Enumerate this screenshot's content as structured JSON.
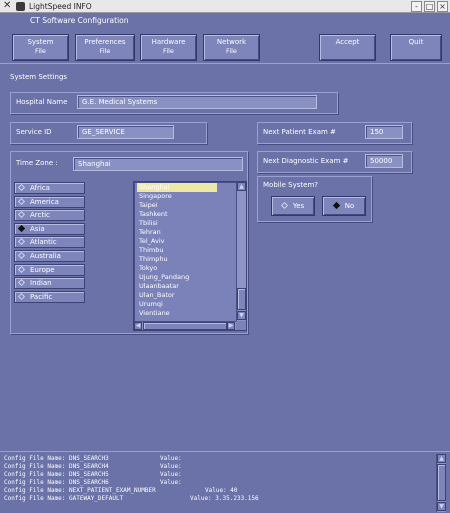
{
  "window": {
    "title": "LightSpeed INFO",
    "buttons": [
      "-",
      "□",
      "×"
    ]
  },
  "app_title": "CT Software Configuration",
  "toolbar": {
    "system": {
      "label": "System",
      "sub": "File"
    },
    "preferences": {
      "label": "Preferences",
      "sub": "File"
    },
    "hardware": {
      "label": "Hardware",
      "sub": "File"
    },
    "network": {
      "label": "Network",
      "sub": "File"
    },
    "accept": "Accept",
    "quit": "Quit"
  },
  "system_settings_label": "System Settings",
  "hospital": {
    "label": "Hospital Name",
    "value": "G.E. Medical Systems"
  },
  "service": {
    "label": "Service ID",
    "value": "GE_SERVICE"
  },
  "next_patient": {
    "label": "Next Patient Exam #",
    "value": "150"
  },
  "next_diagnostic": {
    "label": "Next Diagnostic Exam #",
    "value": "50000"
  },
  "timezone": {
    "label": "Time Zone :",
    "value": "Shanghai",
    "regions": [
      {
        "label": "Africa",
        "selected": false
      },
      {
        "label": "America",
        "selected": false
      },
      {
        "label": "Arctic",
        "selected": false
      },
      {
        "label": "Asia",
        "selected": true
      },
      {
        "label": "Atlantic",
        "selected": false
      },
      {
        "label": "Australia",
        "selected": false
      },
      {
        "label": "Europe",
        "selected": false
      },
      {
        "label": "Indian",
        "selected": false
      },
      {
        "label": "Pacific",
        "selected": false
      }
    ],
    "cities": [
      "Shanghai",
      "Singapore",
      "Taipei",
      "Tashkent",
      "Tbilisi",
      "Tehran",
      "Tel_Aviv",
      "Thimbu",
      "Thimphu",
      "Tokyo",
      "Ujung_Pandang",
      "Ulaanbaatar",
      "Ulan_Bator",
      "Urumqi",
      "Vientiane"
    ],
    "selected_city": "Shanghai"
  },
  "mobile": {
    "label": "Mobile System?",
    "yes": "Yes",
    "no": "No",
    "selected": "No"
  },
  "console_lines": [
    {
      "text": "Config File Name: DNS_SEARCH3",
      "value": "Value:"
    },
    {
      "text": "Config File Name: DNS_SEARCH4",
      "value": "Value:"
    },
    {
      "text": "Config File Name: DNS_SEARCH5",
      "value": "Value:"
    },
    {
      "text": "Config File Name: DNS_SEARCH6",
      "value": "Value:"
    },
    {
      "text": "Config File Name: NEXT_PATIENT_EXAM_NUMBER",
      "value": "Value: 40"
    },
    {
      "text": "Config File Name: GATEWAY_DEFAULT",
      "value": "Value: 3.35.233.156"
    }
  ],
  "colors": {
    "background": "#6a72a8",
    "selection": "#ece8a8"
  }
}
